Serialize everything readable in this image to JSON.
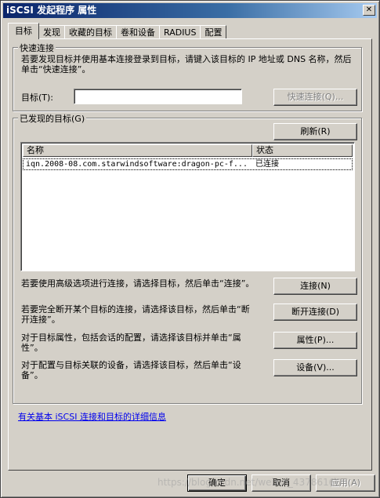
{
  "window": {
    "title": "iSCSI 发起程序 属性",
    "close_glyph": "✕"
  },
  "tabs": [
    {
      "label": "目标",
      "active": true
    },
    {
      "label": "发现"
    },
    {
      "label": "收藏的目标"
    },
    {
      "label": "卷和设备"
    },
    {
      "label": "RADIUS"
    },
    {
      "label": "配置"
    }
  ],
  "quick_connect": {
    "group_title": "快速连接",
    "description": "若要发现目标并使用基本连接登录到目标，请键入该目标的 IP 地址或 DNS 名称，然后单击“快速连接”。",
    "target_label": "目标(T):",
    "target_value": "",
    "quick_connect_button": "快速连接(Q)..."
  },
  "discovered": {
    "group_title": "已发现的目标(G)",
    "refresh_button": "刷新(R)",
    "columns": [
      "名称",
      "状态"
    ],
    "rows": [
      {
        "name": "iqn.2008-08.com.starwindsoftware:dragon-pc-f...",
        "status": "已连接"
      }
    ]
  },
  "actions": [
    {
      "description": "若要使用高级选项进行连接，请选择目标，然后单击“连接”。",
      "button": "连接(N)"
    },
    {
      "description": "若要完全断开某个目标的连接，请选择该目标，然后单击“断开连接”。",
      "button": "断开连接(D)"
    },
    {
      "description": "对于目标属性，包括会话的配置，请选择该目标并单击“属性”。",
      "button": "属性(P)..."
    },
    {
      "description": "对于配置与目标关联的设备，请选择该目标，然后单击“设备”。",
      "button": "设备(V)..."
    }
  ],
  "help_link": "有关基本 iSCSI 连接和目标的详细信息",
  "footer": {
    "ok": "确定",
    "cancel": "取消",
    "apply": "应用(A)"
  },
  "watermark": "https://blog.csdn.net/weixin_43786166"
}
